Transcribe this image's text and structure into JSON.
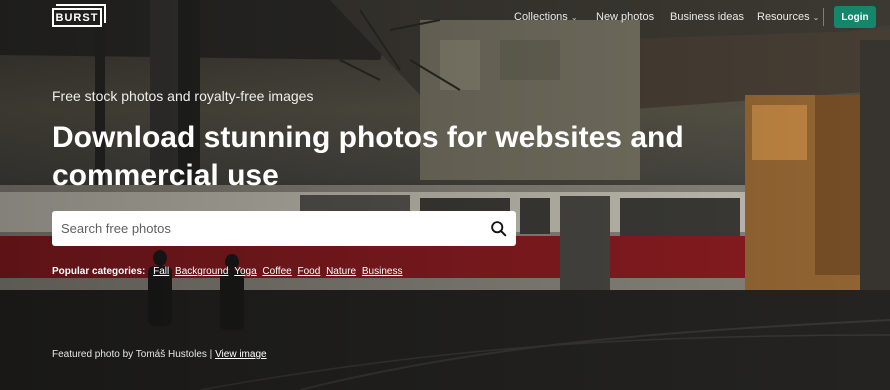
{
  "nav": {
    "logo": "BURST",
    "links": [
      {
        "label": "Collections",
        "has_dropdown": true
      },
      {
        "label": "New photos",
        "has_dropdown": false
      },
      {
        "label": "Business ideas",
        "has_dropdown": false
      },
      {
        "label": "Resources",
        "has_dropdown": true
      }
    ],
    "login_label": "Login"
  },
  "hero": {
    "eyebrow": "Free stock photos and royalty-free images",
    "headline": "Download stunning photos for websites and commercial use",
    "search": {
      "placeholder": "Search free photos"
    },
    "categories_label": "Popular categories:",
    "categories": [
      "Fall",
      "Background",
      "Yoga",
      "Coffee",
      "Food",
      "Nature",
      "Business"
    ],
    "credit_text": "Featured photo by Tomáš Hustoles |",
    "credit_link": "View image"
  },
  "colors": {
    "accent": "#15866a",
    "text": "#ffffff"
  },
  "icons": {
    "search": "search-icon",
    "dropdown": "chevron-down-icon"
  }
}
